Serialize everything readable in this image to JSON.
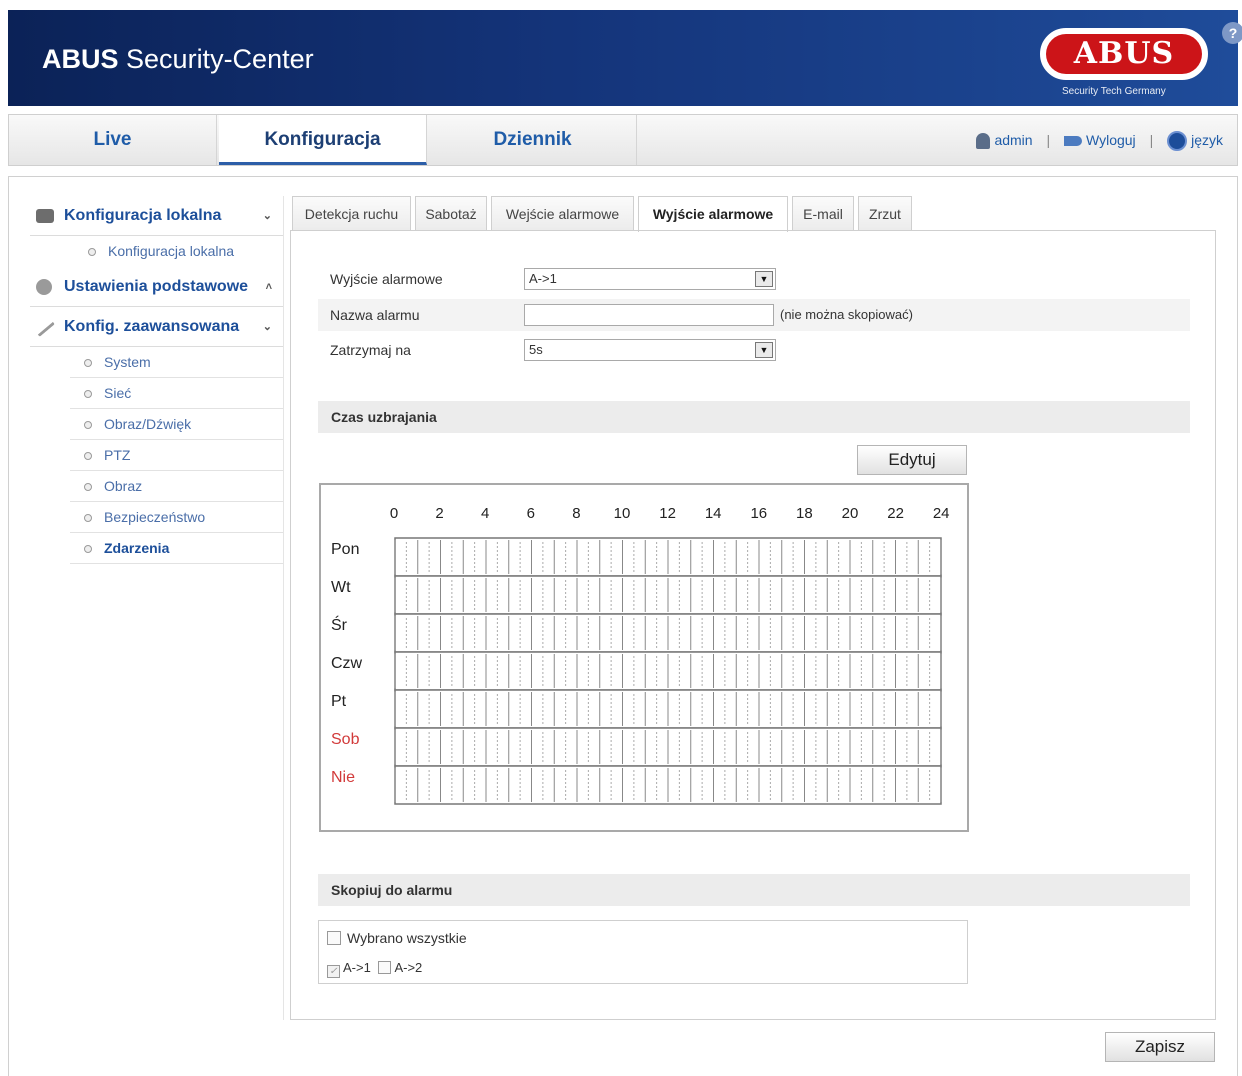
{
  "header": {
    "brand_bold": "ABUS",
    "brand_rest": "Security-Center",
    "logo_text": "ABUS",
    "logo_tagline": "Security Tech Germany",
    "help_symbol": "?"
  },
  "nav": {
    "tabs": [
      {
        "label": "Live"
      },
      {
        "label": "Konfiguracja"
      },
      {
        "label": "Dziennik"
      }
    ],
    "user": "admin",
    "logout": "Wyloguj",
    "language": "język",
    "separator": "|"
  },
  "sidebar": {
    "local_config": {
      "label": "Konfiguracja lokalna",
      "chevron": "⌄",
      "sub": "Konfiguracja lokalna"
    },
    "basic": {
      "label": "Ustawienia podstawowe",
      "chevron": "˄"
    },
    "advanced": {
      "label": "Konfig. zaawansowana",
      "chevron": "⌄"
    },
    "items": [
      {
        "label": "System"
      },
      {
        "label": "Sieć"
      },
      {
        "label": "Obraz/Dźwięk"
      },
      {
        "label": "PTZ"
      },
      {
        "label": "Obraz"
      },
      {
        "label": "Bezpieczeństwo"
      },
      {
        "label": "Zdarzenia"
      }
    ]
  },
  "tabs": [
    {
      "label": "Detekcja ruchu"
    },
    {
      "label": "Sabotaż"
    },
    {
      "label": "Wejście alarmowe"
    },
    {
      "label": "Wyjście alarmowe"
    },
    {
      "label": "E-mail"
    },
    {
      "label": "Zrzut"
    }
  ],
  "form": {
    "output_label": "Wyjście alarmowe",
    "output_value": "A->1",
    "name_label": "Nazwa alarmu",
    "name_value": "",
    "name_note": "(nie można skopiować)",
    "delay_label": "Zatrzymaj na",
    "delay_value": "5s"
  },
  "schedule": {
    "title": "Czas uzbrajania",
    "edit_label": "Edytuj",
    "hours": [
      "0",
      "2",
      "4",
      "6",
      "8",
      "10",
      "12",
      "14",
      "16",
      "18",
      "20",
      "22",
      "24"
    ],
    "days": [
      "Pon",
      "Wt",
      "Śr",
      "Czw",
      "Pt",
      "Sob",
      "Nie"
    ]
  },
  "copy": {
    "title": "Skopiuj do alarmu",
    "select_all": "Wybrano wszystkie",
    "opt1": "A->1",
    "opt2": "A->2",
    "check_mark": "✓"
  },
  "save_label": "Zapisz"
}
